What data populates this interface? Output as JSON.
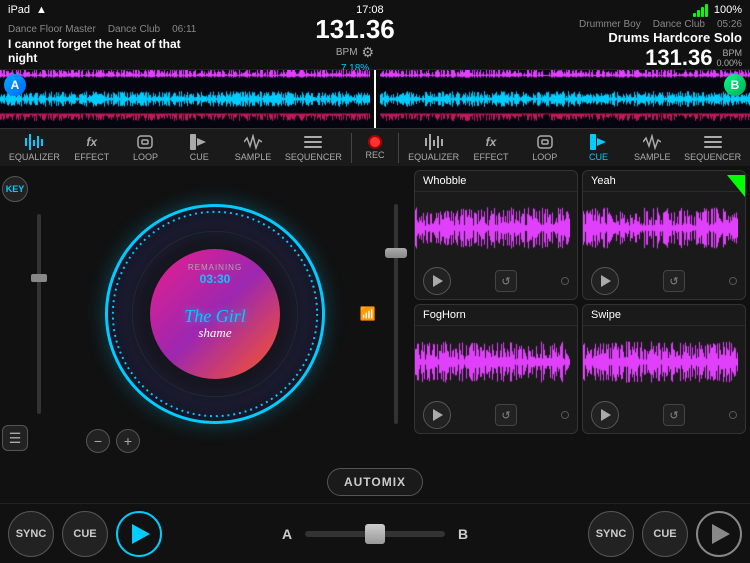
{
  "statusBar": {
    "device": "iPad",
    "wifi": "wifi",
    "time": "17:08",
    "battery": "100%"
  },
  "headerLeft": {
    "genre": "Dance Floor Master",
    "subgenre": "Dance Club",
    "time": "06:11",
    "title": "I cannot forget the heat of that night"
  },
  "headerCenter": {
    "bpm": "131.36",
    "bpmLabel": "BPM",
    "bpmPercent": "7.18%"
  },
  "headerRight": {
    "genre": "Drummer Boy",
    "subgenre": "Dance Club",
    "time": "05:26",
    "title": "Drums Hardcore Solo",
    "bpm": "131.36",
    "bpmPercent": "0.00%"
  },
  "toolbarLeft": {
    "buttons": [
      {
        "id": "equalizer",
        "label": "EQUALIZER"
      },
      {
        "id": "effect",
        "label": "EFFECT"
      },
      {
        "id": "loop",
        "label": "LOOP"
      },
      {
        "id": "cue",
        "label": "CUE"
      },
      {
        "id": "sample",
        "label": "SAMPLE"
      },
      {
        "id": "sequencer",
        "label": "SEQUENCER"
      }
    ]
  },
  "toolbarCenter": {
    "label": "REC"
  },
  "toolbarRight": {
    "buttons": [
      {
        "id": "equalizer-r",
        "label": "EQUALIZER"
      },
      {
        "id": "effect-r",
        "label": "EFFECT"
      },
      {
        "id": "loop-r",
        "label": "LOOP"
      },
      {
        "id": "cue-r",
        "label": "CUE"
      },
      {
        "id": "sample-r",
        "label": "SAMPLE"
      },
      {
        "id": "sequencer-r",
        "label": "SEQUENCER"
      }
    ]
  },
  "deckLeft": {
    "keyLabel": "KEY",
    "remaining": "REMAINING",
    "remainingTime": "03:30",
    "albumTitle": "The Girl",
    "albumSubtitle": "shame"
  },
  "samples": {
    "row1": [
      {
        "name": "Whobble"
      },
      {
        "name": "Yeah"
      }
    ],
    "row2": [
      {
        "name": "FogHorn"
      },
      {
        "name": "Swipe"
      }
    ]
  },
  "transport": {
    "syncLabel": "SYNC",
    "cueLabel": "CUE",
    "deckA": "A",
    "deckB": "B",
    "automix": "AUTOMIX"
  }
}
